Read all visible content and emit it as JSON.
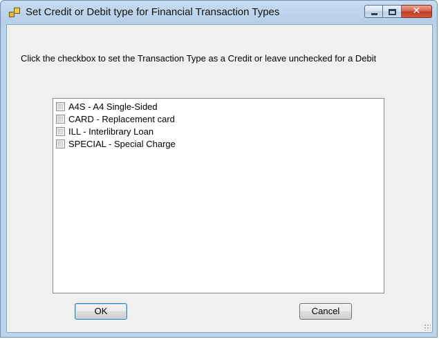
{
  "window": {
    "title": "Set Credit or Debit type for Financial Transaction Types"
  },
  "instructions": "Click the checkbox to set the Transaction Type as a Credit or leave unchecked for a Debit",
  "transaction_types": [
    {
      "label": "A4S - A4 Single-Sided",
      "checked": false
    },
    {
      "label": "CARD - Replacement card",
      "checked": false
    },
    {
      "label": "ILL - Interlibrary Loan",
      "checked": false
    },
    {
      "label": "SPECIAL - Special Charge",
      "checked": false
    }
  ],
  "buttons": {
    "ok": "OK",
    "cancel": "Cancel"
  },
  "icons": {
    "app": "app-form-icon",
    "minimize": "minimize-icon",
    "maximize": "maximize-icon",
    "close": "close-icon"
  },
  "colors": {
    "close_button": "#c0391f",
    "title_bar": "#bcd3ec",
    "client_background": "#f0f0f0"
  }
}
